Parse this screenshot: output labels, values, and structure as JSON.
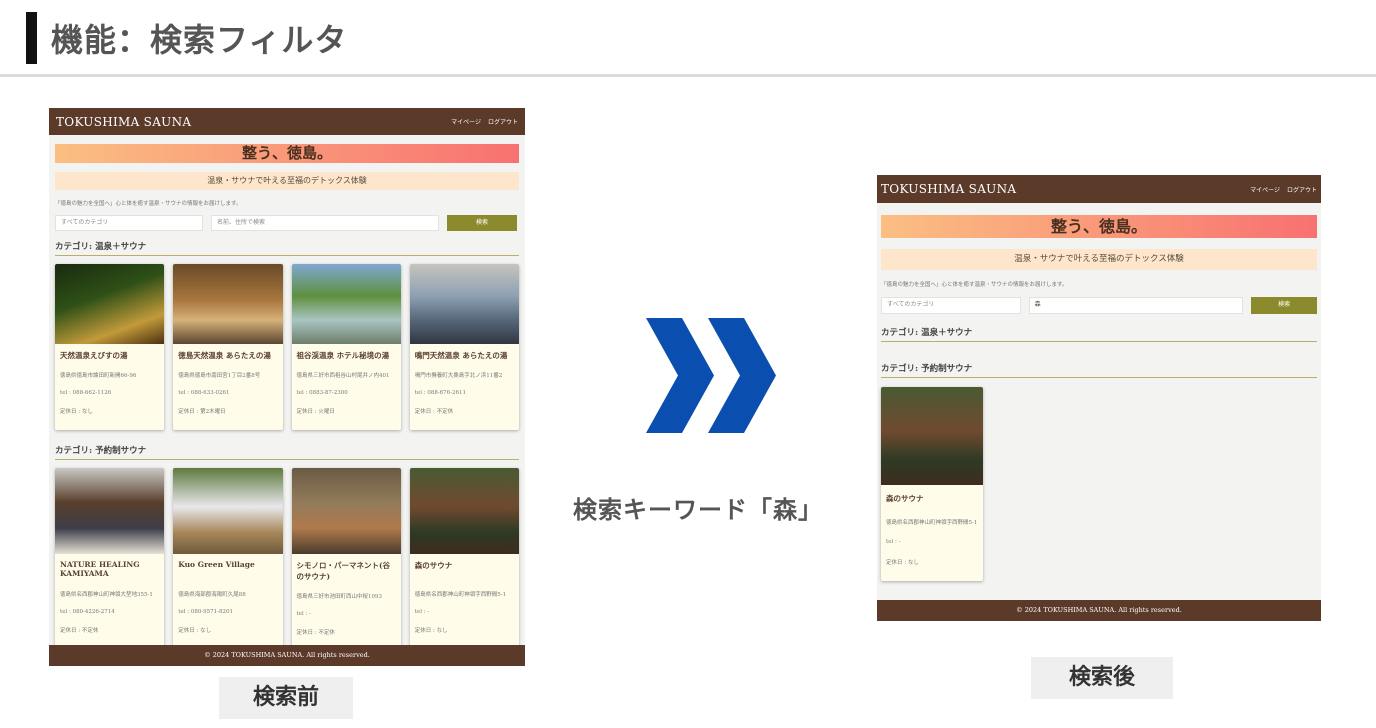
{
  "slide": {
    "title": "機能：検索フィルタ"
  },
  "keyword_caption": "検索キーワード「森」",
  "before_label": "検索前",
  "after_label": "検索後",
  "site": {
    "logo": "TOKUSHIMA SAUNA",
    "nav": [
      "マイページ",
      "ログアウト"
    ],
    "hero": "整う、徳島。",
    "subtitle": "温泉・サウナで叶える至福のデトックス体験",
    "intro": "「徳島の魅力を全国へ」心と体を癒す温泉・サウナの情報をお届けします。",
    "category_select": "すべてのカテゴリ",
    "search_placeholder": "名前、住所で検索",
    "search_button": "検索",
    "footer": "© 2024 TOKUSHIMA SAUNA. All rights reserved."
  },
  "before": {
    "sections": [
      {
        "heading": "カテゴリ: 温泉＋サウナ",
        "cards": [
          {
            "name": "天然温泉えびすの湯",
            "address": "徳島県徳島市論田町新開66-96",
            "tel": "tel : 088-662-1126",
            "holiday": "定休日 : なし"
          },
          {
            "name": "徳島天然温泉 あらたえの湯",
            "address": "徳島県徳島市南田宮1丁目2番8号",
            "tel": "tel : 088-633-0261",
            "holiday": "定休日 : 第2木曜日"
          },
          {
            "name": "祖谷渓温泉 ホテル秘境の湯",
            "address": "徳島県三好市西祖谷山村尾井ノ内401",
            "tel": "tel : 0883-87-2300",
            "holiday": "定休日 : 火曜日"
          },
          {
            "name": "鳴門天然温泉 あらたえの湯",
            "address": "鳴門市撫養町大桑島字北ノ浜11番2",
            "tel": "tel : 088-676-2611",
            "holiday": "定休日 : 不定休"
          }
        ]
      },
      {
        "heading": "カテゴリ: 予約制サウナ",
        "cards": [
          {
            "name": "NATURE HEALING KAMIYAMA",
            "address": "徳島県名西郡神山町神領大埜地355-1",
            "tel": "tel : 080-4226-2714",
            "holiday": "定休日 : 不定休"
          },
          {
            "name": "Kuo Green Village",
            "address": "徳島県海部郡海陽町久尾88",
            "tel": "tel : 080-9571-8201",
            "holiday": "定休日 : なし"
          },
          {
            "name": "シモノロ・パーマネント(谷のサウナ)",
            "address": "徳島県三好市池田町西山中桜1093",
            "tel": "tel : -",
            "holiday": "定休日 : 不定休"
          },
          {
            "name": "森のサウナ",
            "address": "徳島県名西郡神山町神領字西野間5-1",
            "tel": "tel : -",
            "holiday": "定休日 : なし"
          }
        ]
      }
    ]
  },
  "after": {
    "search_value": "森",
    "sections": [
      {
        "heading": "カテゴリ: 温泉＋サウナ",
        "cards": []
      },
      {
        "heading": "カテゴリ: 予約制サウナ",
        "cards": [
          {
            "name": "森のサウナ",
            "address": "徳島県名西郡神山町神領字西野間5-1",
            "tel": "tel : -",
            "holiday": "定休日 : なし"
          }
        ]
      }
    ]
  },
  "colors": {
    "header": "#5c3a2a",
    "button": "#8b8a2c",
    "chevron": "#0a4fb0",
    "card": "#fffdea"
  }
}
